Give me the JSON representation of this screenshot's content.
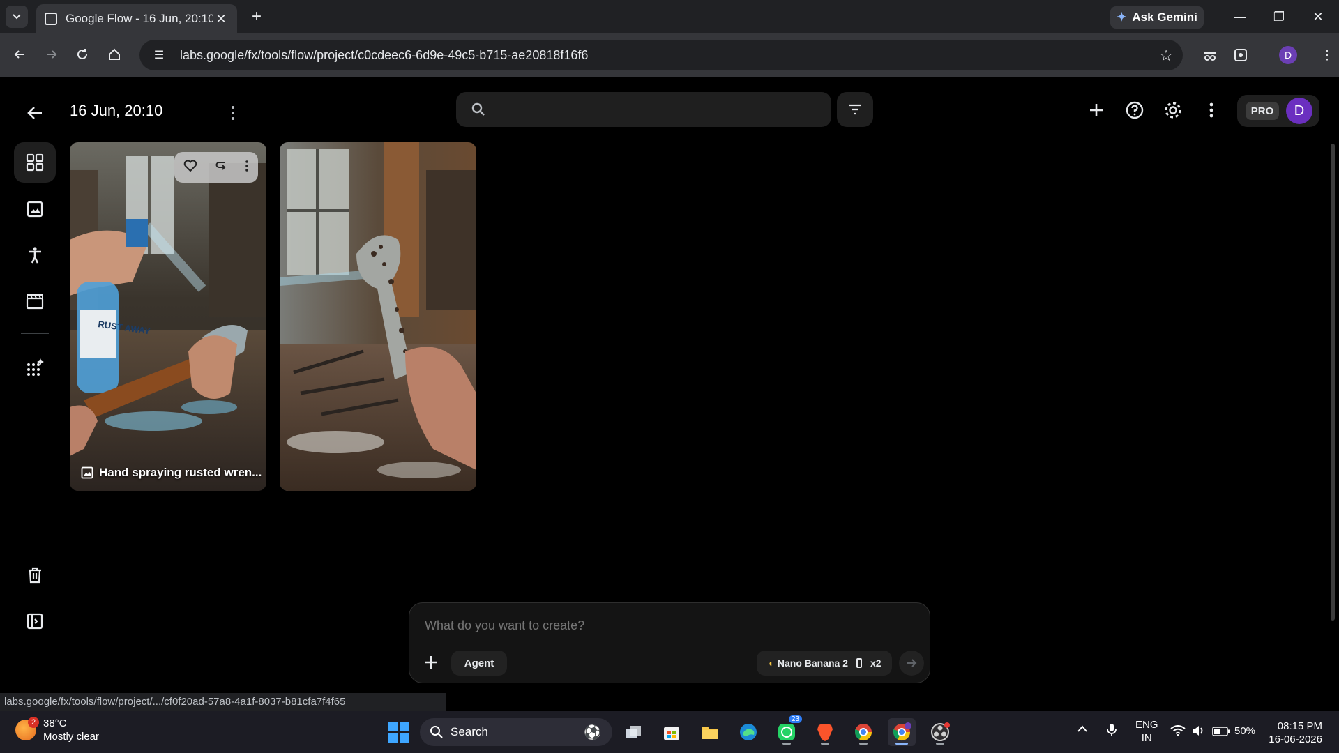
{
  "browser": {
    "tab_title": "Google Flow - 16 Jun, 20:10",
    "ask_gemini_label": "Ask Gemini",
    "url": "labs.google/fx/tools/flow/project/c0cdeec6-6d9e-49c5-b715-ae20818f16f6",
    "profile_initial": "D"
  },
  "header": {
    "project_title": "16 Jun, 20:10",
    "pro_label": "PRO",
    "avatar_initial": "D"
  },
  "cards": [
    {
      "caption": "Hand spraying rusted wren...",
      "bottle_label": "RUST AWAY"
    },
    {
      "caption": ""
    }
  ],
  "composer": {
    "placeholder": "What do you want to create?",
    "agent_label": "Agent",
    "model_label": "Nano Banana 2",
    "count_label": "x2"
  },
  "status_bar": {
    "hover_url": "labs.google/fx/tools/flow/project/.../cf0f20ad-57a8-4a1f-8037-b81cfa7f4f65"
  },
  "taskbar": {
    "weather_temp": "38°C",
    "weather_desc": "Mostly clear",
    "weather_badge": "2",
    "search_label": "Search",
    "whatsapp_badge": "23",
    "lang_line1": "ENG",
    "lang_line2": "IN",
    "battery": "50%",
    "time": "08:15 PM",
    "date": "16-06-2026"
  },
  "colors": {
    "accent_purple": "#6b2fc0",
    "background": "#000000",
    "chrome_dark": "#202124"
  }
}
